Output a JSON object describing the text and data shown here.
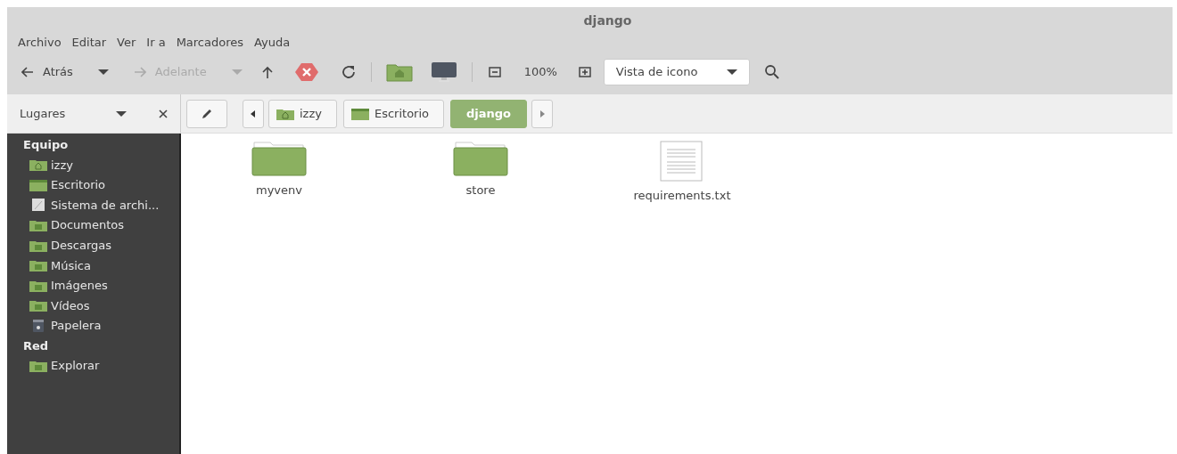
{
  "window": {
    "title": "django"
  },
  "menu": [
    "Archivo",
    "Editar",
    "Ver",
    "Ir a",
    "Marcadores",
    "Ayuda"
  ],
  "toolbar": {
    "back": {
      "label": "Atrás",
      "disabled": false
    },
    "forward": {
      "label": "Adelante",
      "disabled": true
    },
    "zoom": "100%",
    "view": "Vista de icono"
  },
  "sidebar": {
    "title": "Lugares",
    "sections": [
      {
        "heading": "Equipo",
        "items": [
          {
            "label": "izzy",
            "kind": "home"
          },
          {
            "label": "Escritorio",
            "kind": "desktop"
          },
          {
            "label": "Sistema de archi...",
            "kind": "drive"
          },
          {
            "label": "Documentos",
            "kind": "folder"
          },
          {
            "label": "Descargas",
            "kind": "folder"
          },
          {
            "label": "Música",
            "kind": "folder"
          },
          {
            "label": "Imágenes",
            "kind": "folder"
          },
          {
            "label": "Vídeos",
            "kind": "folder"
          },
          {
            "label": "Papelera",
            "kind": "trash"
          }
        ]
      },
      {
        "heading": "Red",
        "items": [
          {
            "label": "Explorar",
            "kind": "folder"
          }
        ]
      }
    ]
  },
  "path": [
    {
      "label": "izzy",
      "kind": "home",
      "selected": false
    },
    {
      "label": "Escritorio",
      "kind": "desktop",
      "selected": false
    },
    {
      "label": "django",
      "selected": true
    }
  ],
  "files": [
    {
      "label": "myvenv",
      "kind": "folder"
    },
    {
      "label": "store",
      "kind": "folder"
    },
    {
      "label": "requirements.txt",
      "kind": "text"
    }
  ]
}
